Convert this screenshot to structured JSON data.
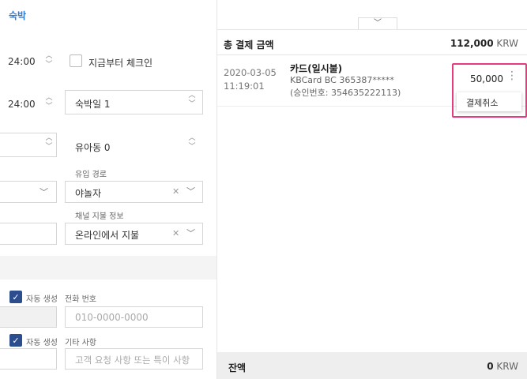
{
  "left": {
    "section_title": "숙박",
    "checkin_time": "24:00",
    "checkout_time": "24:00",
    "checkin_now_label": "지금부터 체크인",
    "nights_value": "숙박일 1",
    "infant_value": "유아동 0",
    "inflow_label": "유입 경로",
    "inflow_value": "야놀자",
    "channel_label": "채널 지불 정보",
    "channel_value": "온라인에서 지불",
    "auto_gen_1": "자동 생성",
    "phone_label": "전화 번호",
    "phone_placeholder": "010-0000-0000",
    "auto_gen_2": "자동 생성",
    "etc_label": "기타 사항",
    "etc_placeholder": "고객 요청 사항 또는 특이 사항"
  },
  "right": {
    "total_label": "총 결제 금액",
    "total_amount": "112,000",
    "currency": "KRW",
    "payment": {
      "date": "2020-03-05",
      "time": "11:19:01",
      "method": "카드(일시불)",
      "card": "KBCard BC 365387*****",
      "approval": "(승인번호: 354635222113)",
      "amount": "50,000"
    },
    "menu_cancel": "결제취소",
    "balance_label": "잔액",
    "balance_amount": "0",
    "balance_currency": "KRW"
  },
  "icons": {
    "up": "chevron-up-icon",
    "down": "chevron-down-icon",
    "clear": "clear-icon",
    "more": "more-vertical-icon",
    "check": "check-icon"
  },
  "colors": {
    "accent": "#2a7ad8",
    "highlight": "#e83a83",
    "checkbox": "#2c4e8f"
  }
}
